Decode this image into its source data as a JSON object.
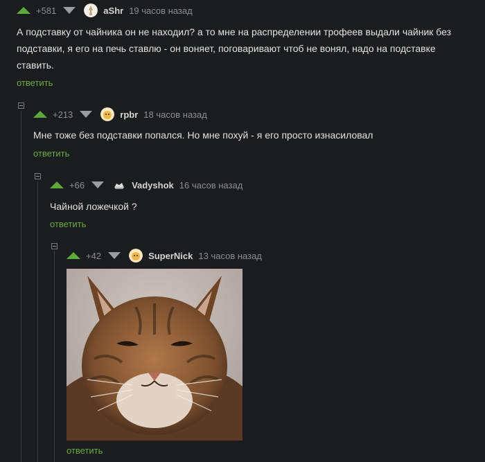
{
  "comments": [
    {
      "rating": "+581",
      "user": "aShr",
      "time": "19 часов назад",
      "text": "А подставку от чайника он не находил? а то мне на распределении трофеев выдали чайник без подставки, я его на печь ставлю - он воняет, поговаривают чтоб не вонял, надо на подставке ставить.",
      "reply": "ответить"
    },
    {
      "rating": "+213",
      "user": "rpbr",
      "time": "18 часов назад",
      "text": "Мне тоже без подставки попался. Но мне похуй - я его просто изнасиловал",
      "reply": "ответить"
    },
    {
      "rating": "+66",
      "user": "Vadyshok",
      "time": "16 часов назад",
      "text": "Чайной ложечкой ?",
      "reply": "ответить"
    },
    {
      "rating": "+42",
      "user": "SuperNick",
      "time": "13 часов назад",
      "reply": "ответить"
    }
  ],
  "icons": {
    "upvote": "arrow-up-icon",
    "downvote": "arrow-down-icon",
    "collapse": "minus-icon"
  },
  "colors": {
    "upvote": "#5fa93b",
    "reply": "#6aac3d",
    "background": "#1b1c1d"
  }
}
